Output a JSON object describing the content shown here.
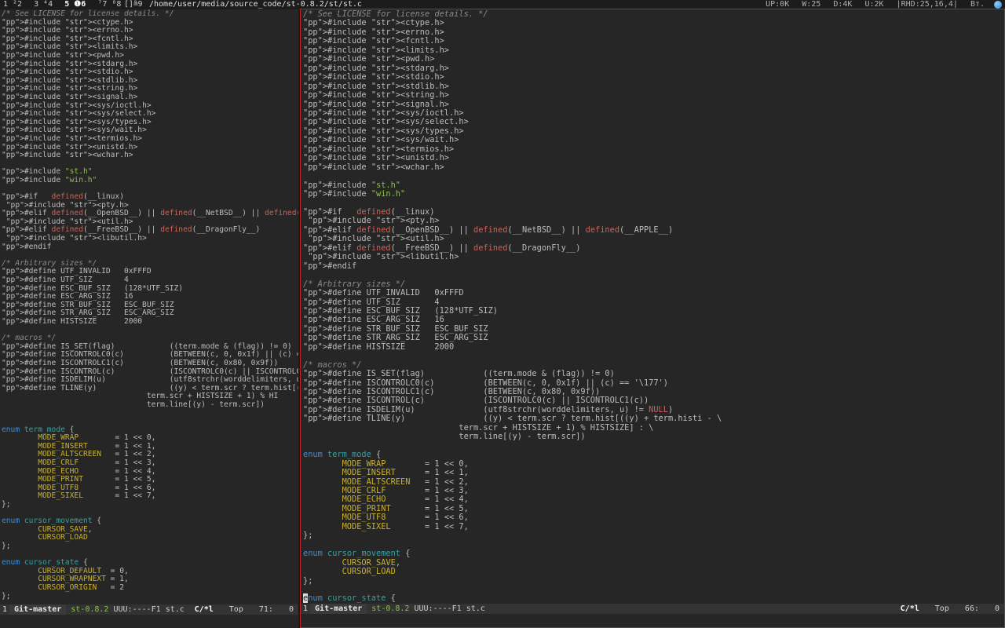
{
  "topbar": {
    "workspaces": [
      {
        "label": "1 ²2"
      },
      {
        "label": "3 ⁴4"
      },
      {
        "label": "5 ❶6"
      },
      {
        "label": "⁷7 ⁸8"
      },
      {
        "label": "⁹9"
      }
    ],
    "layout": "[]=",
    "window_title": "/home/user/media/source_code/st-0.8.2/st/st.c",
    "status": [
      "UP:0K",
      "W:25",
      "D:4K",
      "U:2K",
      "|RHD:25,16,4|",
      "Вт."
    ],
    "tray_icon": "network-icon"
  },
  "left_pane": {
    "modeline": {
      "index": "1",
      "branch": "Git-master",
      "project": "st-0.8.2",
      "state": "UUU:----F1",
      "file": "st.c",
      "mode": "C/*l",
      "position": "Top",
      "line": "71:",
      "column": "0"
    }
  },
  "right_pane": {
    "modeline": {
      "index": "1",
      "branch": "Git-master",
      "project": "st-0.8.2",
      "state": "UUU:----F1",
      "file": "st.c",
      "mode": "C/*l",
      "position": "Top",
      "line": "66:",
      "column": "0"
    }
  },
  "colors": {
    "comment": "#8a8a8a",
    "preprocessor": "#c8645a",
    "string": "#8fbf4f",
    "keyword": "#3b8ed8",
    "type": "#3aa0a0",
    "constant": "#c8b030",
    "active_border": "#c02020",
    "background": "#262626"
  },
  "code_lines_left": [
    "/* See LICENSE for license details. */",
    "#include <ctype.h>",
    "#include <errno.h>",
    "#include <fcntl.h>",
    "#include <limits.h>",
    "#include <pwd.h>",
    "#include <stdarg.h>",
    "#include <stdio.h>",
    "#include <stdlib.h>",
    "#include <string.h>",
    "#include <signal.h>",
    "#include <sys/ioctl.h>",
    "#include <sys/select.h>",
    "#include <sys/types.h>",
    "#include <sys/wait.h>",
    "#include <termios.h>",
    "#include <unistd.h>",
    "#include <wchar.h>",
    "",
    "#include \"st.h\"",
    "#include \"win.h\"",
    "",
    "#if   defined(__linux)",
    " #include <pty.h>",
    "#elif defined(__OpenBSD__) || defined(__NetBSD__) || defined(",
    " #include <util.h>",
    "#elif defined(__FreeBSD__) || defined(__DragonFly__)",
    " #include <libutil.h>",
    "#endif",
    "",
    "/* Arbitrary sizes */",
    "#define UTF_INVALID   0xFFFD",
    "#define UTF_SIZ       4",
    "#define ESC_BUF_SIZ   (128*UTF_SIZ)",
    "#define ESC_ARG_SIZ   16",
    "#define STR_BUF_SIZ   ESC_BUF_SIZ",
    "#define STR_ARG_SIZ   ESC_ARG_SIZ",
    "#define HISTSIZE      2000",
    "",
    "/* macros */",
    "#define IS_SET(flag)            ((term.mode & (flag)) != 0)",
    "#define ISCONTROLC0(c)          (BETWEEN(c, 0, 0x1f) || (c) =",
    "#define ISCONTROLC1(c)          (BETWEEN(c, 0x80, 0x9f))",
    "#define ISCONTROL(c)            (ISCONTROLC0(c) || ISCONTROLC",
    "#define ISDELIM(u)              (utf8strchr(worddelimiters, u",
    "#define TLINE(y)                ((y) < term.scr ? term.hist[(",
    "                                term.scr + HISTSIZE + 1) % HI",
    "                                term.line[(y) - term.scr])",
    "",
    "",
    "enum term_mode {",
    "        MODE_WRAP        = 1 << 0,",
    "        MODE_INSERT      = 1 << 1,",
    "        MODE_ALTSCREEN   = 1 << 2,",
    "        MODE_CRLF        = 1 << 3,",
    "        MODE_ECHO        = 1 << 4,",
    "        MODE_PRINT       = 1 << 5,",
    "        MODE_UTF8        = 1 << 6,",
    "        MODE_SIXEL       = 1 << 7,",
    "};",
    "",
    "enum cursor_movement {",
    "        CURSOR_SAVE,",
    "        CURSOR_LOAD",
    "};",
    "",
    "enum cursor_state {",
    "        CURSOR_DEFAULT  = 0,",
    "        CURSOR_WRAPNEXT = 1,",
    "        CURSOR_ORIGIN   = 2",
    "};"
  ],
  "code_lines_right": [
    "/* See LICENSE for license details. */",
    "#include <ctype.h>",
    "#include <errno.h>",
    "#include <fcntl.h>",
    "#include <limits.h>",
    "#include <pwd.h>",
    "#include <stdarg.h>",
    "#include <stdio.h>",
    "#include <stdlib.h>",
    "#include <string.h>",
    "#include <signal.h>",
    "#include <sys/ioctl.h>",
    "#include <sys/select.h>",
    "#include <sys/types.h>",
    "#include <sys/wait.h>",
    "#include <termios.h>",
    "#include <unistd.h>",
    "#include <wchar.h>",
    "",
    "#include \"st.h\"",
    "#include \"win.h\"",
    "",
    "#if   defined(__linux)",
    " #include <pty.h>",
    "#elif defined(__OpenBSD__) || defined(__NetBSD__) || defined(__APPLE__)",
    " #include <util.h>",
    "#elif defined(__FreeBSD__) || defined(__DragonFly__)",
    " #include <libutil.h>",
    "#endif",
    "",
    "/* Arbitrary sizes */",
    "#define UTF_INVALID   0xFFFD",
    "#define UTF_SIZ       4",
    "#define ESC_BUF_SIZ   (128*UTF_SIZ)",
    "#define ESC_ARG_SIZ   16",
    "#define STR_BUF_SIZ   ESC_BUF_SIZ",
    "#define STR_ARG_SIZ   ESC_ARG_SIZ",
    "#define HISTSIZE      2000",
    "",
    "/* macros */",
    "#define IS_SET(flag)            ((term.mode & (flag)) != 0)",
    "#define ISCONTROLC0(c)          (BETWEEN(c, 0, 0x1f) || (c) == '\\177')",
    "#define ISCONTROLC1(c)          (BETWEEN(c, 0x80, 0x9f))",
    "#define ISCONTROL(c)            (ISCONTROLC0(c) || ISCONTROLC1(c))",
    "#define ISDELIM(u)              (utf8strchr(worddelimiters, u) != NULL)",
    "#define TLINE(y)                ((y) < term.scr ? term.hist[((y) + term.histi - \\",
    "                                term.scr + HISTSIZE + 1) % HISTSIZE] : \\",
    "                                term.line[(y) - term.scr])",
    "",
    "enum term_mode {",
    "        MODE_WRAP        = 1 << 0,",
    "        MODE_INSERT      = 1 << 1,",
    "        MODE_ALTSCREEN   = 1 << 2,",
    "        MODE_CRLF        = 1 << 3,",
    "        MODE_ECHO        = 1 << 4,",
    "        MODE_PRINT       = 1 << 5,",
    "        MODE_UTF8        = 1 << 6,",
    "        MODE_SIXEL       = 1 << 7,",
    "};",
    "",
    "enum cursor_movement {",
    "        CURSOR_SAVE,",
    "        CURSOR_LOAD",
    "};",
    "",
    "enum cursor_state {"
  ]
}
